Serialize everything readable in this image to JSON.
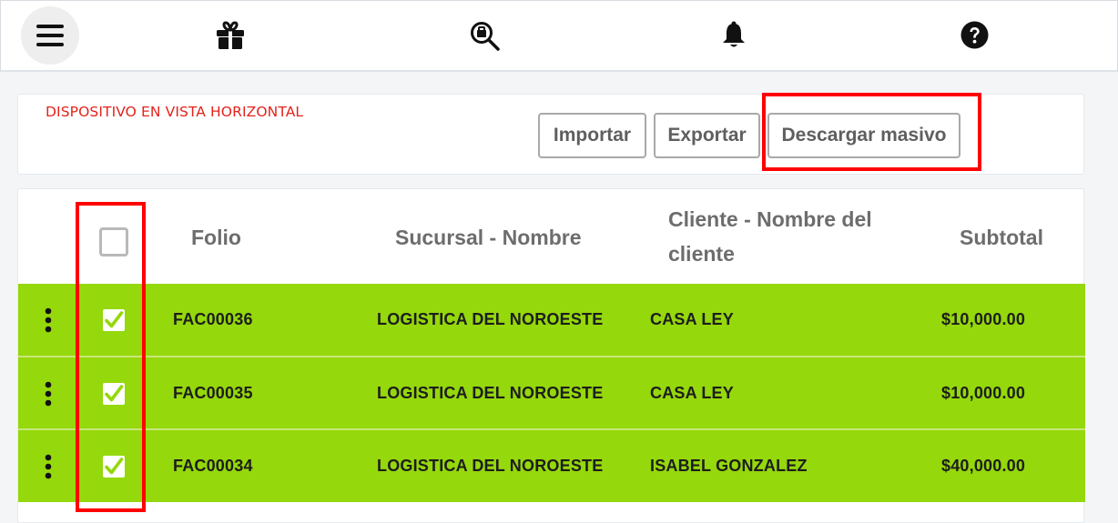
{
  "topbar": {
    "icons": [
      "menu-icon",
      "gift-icon",
      "search-icon",
      "bell-icon",
      "help-icon"
    ]
  },
  "toolbar": {
    "note": "DISPOSITIVO EN VISTA HORIZONTAL",
    "import_label": "Importar",
    "export_label": "Exportar",
    "bulk_download_label": "Descargar masivo"
  },
  "table": {
    "columns": {
      "folio": "Folio",
      "sucursal": "Sucursal - Nombre",
      "cliente": "Cliente - Nombre del cliente",
      "subtotal": "Subtotal"
    },
    "header_checked": false,
    "rows": [
      {
        "folio": "FAC00036",
        "sucursal": "LOGISTICA DEL NOROESTE",
        "cliente": "CASA LEY",
        "subtotal": "$10,000.00",
        "checked": true
      },
      {
        "folio": "FAC00035",
        "sucursal": "LOGISTICA DEL NOROESTE",
        "cliente": "CASA LEY",
        "subtotal": "$10,000.00",
        "checked": true
      },
      {
        "folio": "FAC00034",
        "sucursal": "LOGISTICA DEL NOROESTE",
        "cliente": "ISABEL GONZALEZ",
        "subtotal": "$40,000.00",
        "checked": true
      }
    ]
  },
  "colors": {
    "selected_row": "#95d80b",
    "highlight": "#ff0000",
    "note_text": "#e3231b"
  }
}
